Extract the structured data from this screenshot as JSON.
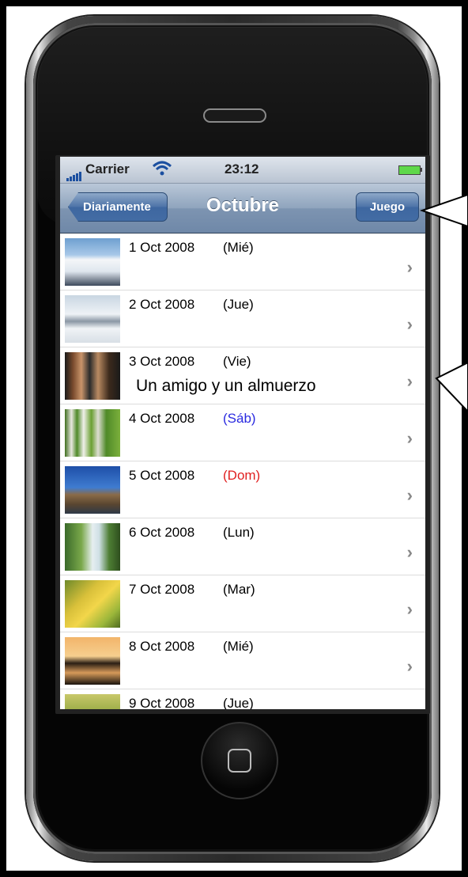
{
  "statusbar": {
    "carrier": "Carrier",
    "time": "23:12"
  },
  "navbar": {
    "back_label": "Diariamente",
    "title": "Octubre",
    "right_label": "Juego"
  },
  "colors": {
    "saturday": "#2a2ae0",
    "sunday": "#e02020",
    "weekday": "#000000"
  },
  "list": [
    {
      "date": "1 Oct 2008",
      "dow": "(Mié)",
      "note": "",
      "dow_color": "weekday",
      "thumb": "snowy-mountain"
    },
    {
      "date": "2 Oct 2008",
      "dow": "(Jue)",
      "note": "",
      "dow_color": "weekday",
      "thumb": "winter-landscape"
    },
    {
      "date": "3 Oct 2008",
      "dow": "(Vie)",
      "note": "Un amigo y un almuerzo",
      "dow_color": "weekday",
      "thumb": "friends-photo"
    },
    {
      "date": "4 Oct 2008",
      "dow": "(Sáb)",
      "note": "",
      "dow_color": "saturday",
      "thumb": "birch-trees"
    },
    {
      "date": "5 Oct 2008",
      "dow": "(Dom)",
      "note": "",
      "dow_color": "sunday",
      "thumb": "rocky-peak"
    },
    {
      "date": "6 Oct 2008",
      "dow": "(Lun)",
      "note": "",
      "dow_color": "weekday",
      "thumb": "waterfall"
    },
    {
      "date": "7 Oct 2008",
      "dow": "(Mar)",
      "note": "",
      "dow_color": "weekday",
      "thumb": "yellow-leaves"
    },
    {
      "date": "8 Oct 2008",
      "dow": "(Mié)",
      "note": "",
      "dow_color": "weekday",
      "thumb": "sunset-lake"
    },
    {
      "date": "9 Oct 2008",
      "dow": "(Jue)",
      "note": "",
      "dow_color": "weekday",
      "thumb": "meadow"
    }
  ]
}
